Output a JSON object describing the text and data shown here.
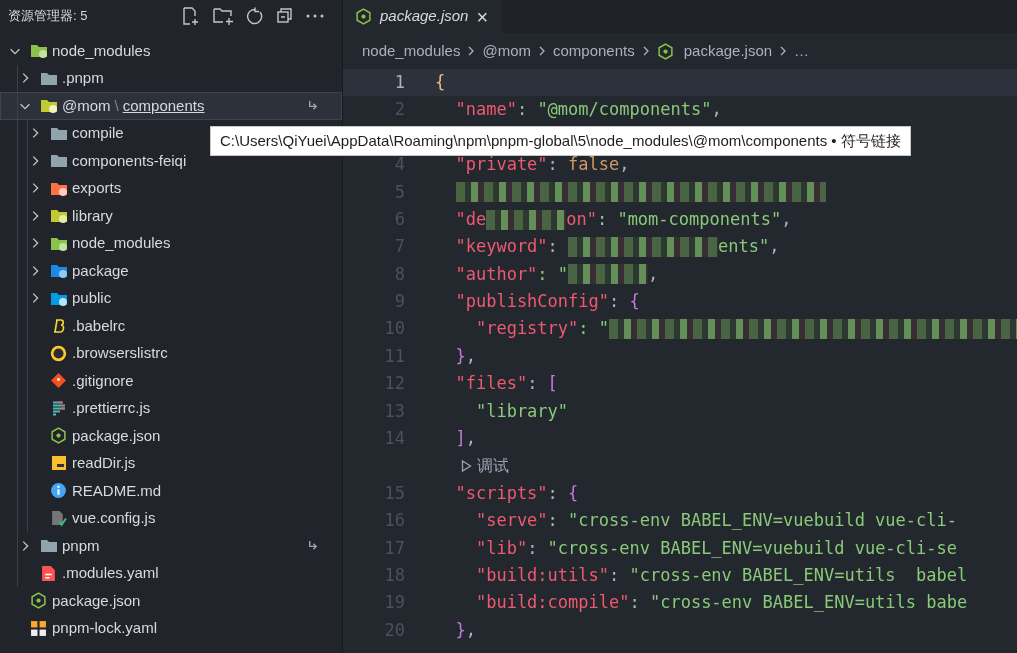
{
  "sidebar": {
    "title": "资源管理器: 5",
    "tree": [
      {
        "label": "node_modules",
        "kind": "folder-node",
        "expanded": true,
        "selected": false,
        "children": [
          {
            "label": ".pnpm",
            "kind": "folder",
            "expanded": false,
            "selected": false,
            "symlink": false
          },
          {
            "label": "@mom",
            "separator": "\\",
            "link_label": "components",
            "kind": "folder-mom",
            "expanded": true,
            "selected": true,
            "symlink": true,
            "children": [
              {
                "label": "compile",
                "kind": "folder",
                "expanded": false,
                "selected": false
              },
              {
                "label": "components-feiqi",
                "kind": "folder",
                "expanded": false,
                "selected": false
              },
              {
                "label": "exports",
                "kind": "folder-exports",
                "expanded": false,
                "selected": false
              },
              {
                "label": "library",
                "kind": "folder-library",
                "expanded": false,
                "selected": false
              },
              {
                "label": "node_modules",
                "kind": "folder-node",
                "expanded": false,
                "selected": false
              },
              {
                "label": "package",
                "kind": "folder-package",
                "expanded": false,
                "selected": false
              },
              {
                "label": "public",
                "kind": "folder-public",
                "expanded": false,
                "selected": false
              },
              {
                "label": ".babelrc",
                "kind": "babel",
                "selected": false
              },
              {
                "label": ".browserslistrc",
                "kind": "browserslist",
                "selected": false
              },
              {
                "label": ".gitignore",
                "kind": "git",
                "selected": false
              },
              {
                "label": ".prettierrc.js",
                "kind": "prettier",
                "selected": false
              },
              {
                "label": "package.json",
                "kind": "nodejs",
                "selected": false
              },
              {
                "label": "readDir.js",
                "kind": "js",
                "selected": false
              },
              {
                "label": "README.md",
                "kind": "info",
                "selected": false
              },
              {
                "label": "vue.config.js",
                "kind": "vue-config",
                "selected": false
              }
            ]
          },
          {
            "label": "pnpm",
            "kind": "folder",
            "expanded": false,
            "selected": false,
            "symlink": true
          },
          {
            "label": ".modules.yaml",
            "kind": "yaml",
            "selected": false,
            "symlink": false
          }
        ]
      },
      {
        "label": "package.json",
        "kind": "nodejs",
        "selected": false
      },
      {
        "label": "pnpm-lock.yaml",
        "kind": "lock",
        "selected": false
      }
    ]
  },
  "tooltip": "C:\\Users\\QiYuei\\AppData\\Roaming\\npm\\pnpm-global\\5\\node_modules\\@mom\\components • 符号链接",
  "tabs": [
    {
      "label": "package.json",
      "selected": true,
      "close": "×"
    }
  ],
  "breadcrumbs": [
    {
      "label": "node_modules"
    },
    {
      "label": "@mom"
    },
    {
      "label": "components"
    },
    {
      "label": "package.json",
      "file": true
    },
    {
      "label": "…"
    }
  ],
  "lines": [
    {
      "kind": "code",
      "number": "1",
      "current": true,
      "tokens": [
        {
          "t": "{",
          "kind": "brace"
        }
      ]
    },
    {
      "kind": "code",
      "number": "2",
      "current": false,
      "tokens": [
        {
          "t": "  \"name\"",
          "kind": "key"
        },
        {
          "t": ": ",
          "kind": "punct"
        },
        {
          "t": "\"@mom/components\"",
          "kind": "str"
        },
        {
          "t": ",",
          "kind": "punct"
        }
      ]
    },
    {
      "kind": "covered"
    },
    {
      "kind": "code",
      "number": "4",
      "current": false,
      "tokens": [
        {
          "t": "  \"private\"",
          "kind": "key"
        },
        {
          "t": ": ",
          "kind": "punct"
        },
        {
          "t": "false",
          "kind": "bool"
        },
        {
          "t": ",",
          "kind": "punct"
        }
      ]
    },
    {
      "kind": "code",
      "number": "5",
      "current": false,
      "tokens": [
        {
          "kind": "redacted-l"
        }
      ]
    },
    {
      "kind": "code",
      "number": "6",
      "current": false,
      "tokens": [
        {
          "t": "  \"de",
          "kind": "key"
        },
        {
          "kind": "redacted-s"
        },
        {
          "t": "on\"",
          "kind": "key"
        },
        {
          "t": ": ",
          "kind": "punct"
        },
        {
          "t": "\"mom-components\"",
          "kind": "str"
        },
        {
          "t": ",",
          "kind": "punct"
        }
      ]
    },
    {
      "kind": "code",
      "number": "7",
      "current": false,
      "tokens": [
        {
          "t": "  \"keyword\"",
          "kind": "key"
        },
        {
          "t": ": ",
          "kind": "punct"
        },
        {
          "kind": "redacted-m"
        },
        {
          "t": "ents\"",
          "kind": "str"
        },
        {
          "t": ",",
          "kind": "punct"
        }
      ]
    },
    {
      "kind": "code",
      "number": "8",
      "current": false,
      "tokens": [
        {
          "t": "  \"author\"",
          "kind": "key"
        },
        {
          "t": ": \"",
          "kind": "str"
        },
        {
          "kind": "redacted-s"
        },
        {
          "t": ",",
          "kind": "punct"
        }
      ]
    },
    {
      "kind": "code",
      "number": "9",
      "current": false,
      "tokens": [
        {
          "t": "  \"publishConfig\"",
          "kind": "key"
        },
        {
          "t": ": ",
          "kind": "punct"
        },
        {
          "t": "{",
          "kind": "brace2"
        }
      ]
    },
    {
      "kind": "code",
      "number": "10",
      "current": false,
      "tokens": [
        {
          "t": "    \"registry\"",
          "kind": "key"
        },
        {
          "t": ": \"",
          "kind": "str"
        },
        {
          "kind": "redacted-fill"
        }
      ]
    },
    {
      "kind": "code",
      "number": "11",
      "current": false,
      "tokens": [
        {
          "t": "  }",
          "kind": "brace2"
        },
        {
          "t": ",",
          "kind": "punct"
        }
      ]
    },
    {
      "kind": "code",
      "number": "12",
      "current": false,
      "tokens": [
        {
          "t": "  \"files\"",
          "kind": "key"
        },
        {
          "t": ": ",
          "kind": "punct"
        },
        {
          "t": "[",
          "kind": "brace2"
        }
      ]
    },
    {
      "kind": "code",
      "number": "13",
      "current": false,
      "tokens": [
        {
          "t": "    \"library\"",
          "kind": "str"
        }
      ]
    },
    {
      "kind": "code",
      "number": "14",
      "current": false,
      "tokens": [
        {
          "t": "  ]",
          "kind": "brace2"
        },
        {
          "t": ",",
          "kind": "punct"
        }
      ]
    },
    {
      "kind": "codelens",
      "text": "调试"
    },
    {
      "kind": "code",
      "number": "15",
      "current": false,
      "tokens": [
        {
          "t": "  \"scripts\"",
          "kind": "key"
        },
        {
          "t": ": ",
          "kind": "punct"
        },
        {
          "t": "{",
          "kind": "brace2"
        }
      ]
    },
    {
      "kind": "code",
      "number": "16",
      "current": false,
      "tokens": [
        {
          "t": "    \"serve\"",
          "kind": "key"
        },
        {
          "t": ": ",
          "kind": "punct"
        },
        {
          "t": "\"cross-env BABEL_ENV=vuebuild vue-cli-",
          "kind": "str"
        }
      ]
    },
    {
      "kind": "code",
      "number": "17",
      "current": false,
      "tokens": [
        {
          "t": "    \"lib\"",
          "kind": "key"
        },
        {
          "t": ": ",
          "kind": "punct"
        },
        {
          "t": "\"cross-env BABEL_ENV=vuebuild vue-cli-se",
          "kind": "str"
        }
      ]
    },
    {
      "kind": "code",
      "number": "18",
      "current": false,
      "tokens": [
        {
          "t": "    \"build:utils\"",
          "kind": "key"
        },
        {
          "t": ": ",
          "kind": "punct"
        },
        {
          "t": "\"cross-env BABEL_ENV=utils  babel",
          "kind": "str"
        }
      ]
    },
    {
      "kind": "code",
      "number": "19",
      "current": false,
      "tokens": [
        {
          "t": "    \"build:compile\"",
          "kind": "key"
        },
        {
          "t": ": ",
          "kind": "punct"
        },
        {
          "t": "\"cross-env BABEL_ENV=utils babe",
          "kind": "str"
        }
      ]
    },
    {
      "kind": "code",
      "number": "20",
      "current": false,
      "tokens": [
        {
          "t": "  }",
          "kind": "brace2"
        },
        {
          "t": ",",
          "kind": "punct"
        }
      ]
    }
  ]
}
